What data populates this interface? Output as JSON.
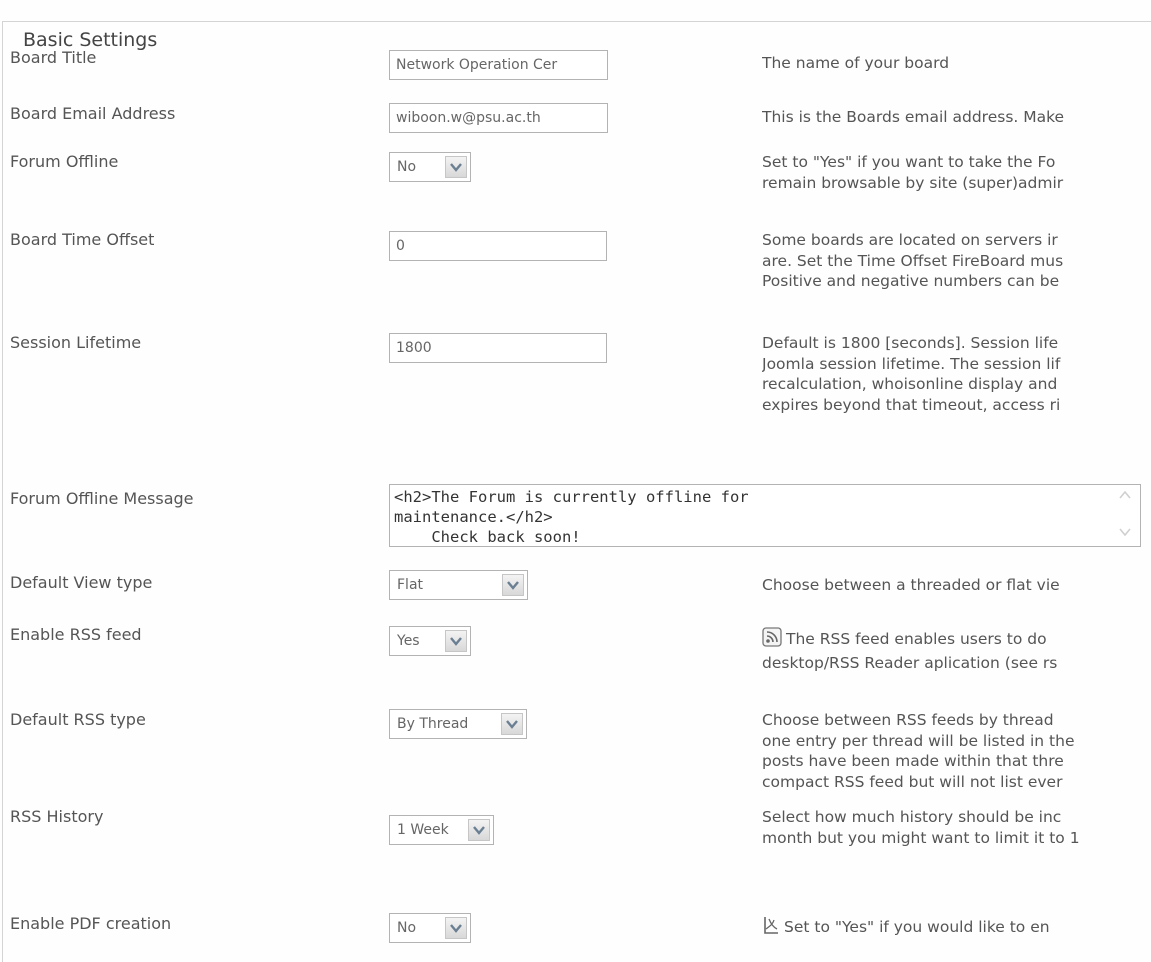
{
  "section": {
    "legend": "Basic Settings"
  },
  "fields": {
    "board_title": {
      "label": "Board Title",
      "value": "Network Operation Cer",
      "desc": [
        "The name of your board"
      ]
    },
    "board_email": {
      "label": "Board Email Address",
      "value": "wiboon.w@psu.ac.th",
      "desc": [
        "This is the Boards email address. Make"
      ]
    },
    "forum_offline": {
      "label": "Forum Offline",
      "value": "No",
      "desc": [
        "Set to \"Yes\" if you want to take the Fo",
        "remain browsable by site (super)admir"
      ]
    },
    "time_offset": {
      "label": "Board Time Offset",
      "value": "0",
      "desc": [
        "Some boards are located on servers ir",
        "are. Set the Time Offset FireBoard mus",
        "Positive and negative numbers can be"
      ]
    },
    "session_lifetime": {
      "label": "Session Lifetime",
      "value": "1800",
      "desc": [
        "Default is 1800 [seconds]. Session life",
        "Joomla session lifetime. The session lif",
        "recalculation, whoisonline display and",
        "expires beyond that timeout, access ri"
      ]
    },
    "offline_message": {
      "label": "Forum Offline Message",
      "lines": [
        "<h2>The Forum is currently offline for",
        "maintenance.</h2>",
        "    Check back soon!"
      ]
    },
    "view_type": {
      "label": "Default View type",
      "value": "Flat",
      "desc": [
        "Choose between a threaded or flat vie"
      ]
    },
    "rss_feed": {
      "label": "Enable RSS feed",
      "value": "Yes",
      "desc": [
        "The RSS feed enables users to do",
        "desktop/RSS Reader aplication (see rs"
      ]
    },
    "rss_type": {
      "label": "Default RSS type",
      "value": "By Thread",
      "desc": [
        "Choose between RSS feeds by thread",
        "one entry per thread will be listed in the",
        "posts have been made within that thre",
        "compact RSS feed but will not list ever"
      ]
    },
    "rss_history": {
      "label": "RSS History",
      "value": "1 Week",
      "desc": [
        "Select how much history should be inc",
        "month but you might want to limit it to 1"
      ]
    },
    "pdf_creation": {
      "label": "Enable PDF creation",
      "value": "No",
      "desc": [
        "Set to \"Yes\" if you would like to en"
      ]
    }
  },
  "icons": {
    "dropdown": "chevron-down-icon",
    "rss": "rss-feed-icon",
    "pdf": "pdf-icon",
    "scroll_up": "scroll-up-icon",
    "scroll_down": "scroll-down-icon"
  }
}
